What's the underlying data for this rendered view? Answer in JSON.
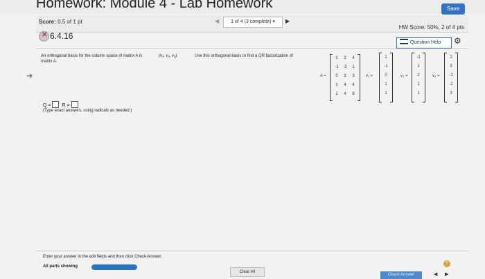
{
  "header": {
    "title": "Homework: Module 4 - Lab Homework",
    "save_label": "Save"
  },
  "scorebar": {
    "score_label": "Score:",
    "score_value": "0.5 of 1 pt",
    "question_selector": "1 of 4 (3 complete) ▾",
    "hw_score": "HW Score: 50%, 2 of 4 pts"
  },
  "question": {
    "number": "6.4.16",
    "help_label": "Question Help",
    "prompt_pre": "An orthogonal basis for the column space of matrix A is",
    "prompt_set": "{v₁, v₂, v₃}.",
    "prompt_post": "Use this orthogonal basis to find a QR factorization of",
    "prompt_line2": "matrix A.",
    "matrix_label": "A =",
    "matrix_A": [
      [
        "1",
        "2",
        "4"
      ],
      [
        "-1",
        "-2",
        "1"
      ],
      [
        "0",
        "2",
        "3"
      ],
      [
        "1",
        "4",
        "4"
      ],
      [
        "1",
        "4",
        "8"
      ]
    ],
    "v1_label": "v₁ =",
    "v1": [
      "1",
      "-1",
      "0",
      "1",
      "1"
    ],
    "v2_label": "v₂ =",
    "v2": [
      "-1",
      "1",
      "2",
      "1",
      "1"
    ],
    "v3_label": "v₃ =",
    "v3": [
      "2",
      "3",
      "-1",
      "-2",
      "3"
    ],
    "answer_q": "Q =",
    "answer_r": "R =",
    "answer_hint": "(Type exact answers, using radicals as needed.)"
  },
  "footer": {
    "instruction": "Enter your answer in the edit fields and then click Check Answer.",
    "all_parts": "All parts showing",
    "progress_fraction": 1.0,
    "clear_label": "Clear All",
    "check_label": "Check Answer",
    "help_glyph": "?"
  },
  "colors": {
    "accent": "#2f74c6",
    "error_mark": "#c0392b"
  },
  "icons": [
    "gear-icon",
    "list-icon",
    "incorrect-icon",
    "prev-arrow-icon",
    "next-arrow-icon",
    "help-icon"
  ]
}
